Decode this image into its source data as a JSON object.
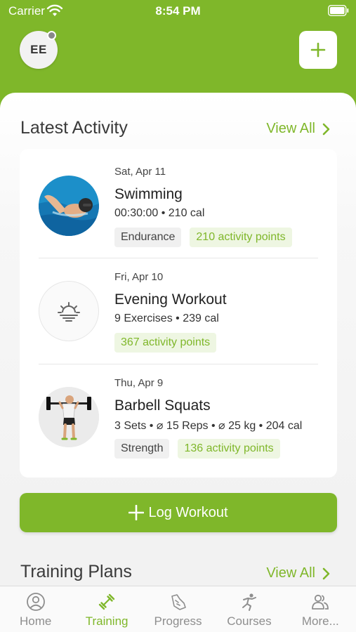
{
  "status_bar": {
    "carrier": "Carrier",
    "time": "8:54 PM"
  },
  "header": {
    "avatar_initials": "EE"
  },
  "latest_activity": {
    "title": "Latest Activity",
    "view_all": "View All",
    "items": [
      {
        "date": "Sat, Apr 11",
        "name": "Swimming",
        "stats": "00:30:00 • 210 cal",
        "tags": [
          {
            "label": "Endurance",
            "style": "grey"
          },
          {
            "label": "210 activity points",
            "style": "green"
          }
        ]
      },
      {
        "date": "Fri, Apr 10",
        "name": "Evening Workout",
        "stats": "9 Exercises • 239 cal",
        "tags": [
          {
            "label": "367 activity points",
            "style": "green"
          }
        ]
      },
      {
        "date": "Thu, Apr 9",
        "name": "Barbell Squats",
        "stats": "3 Sets • ⌀ 15 Reps • ⌀ 25 kg • 204 cal",
        "tags": [
          {
            "label": "Strength",
            "style": "grey"
          },
          {
            "label": "136 activity points",
            "style": "green"
          }
        ]
      }
    ]
  },
  "log_workout": {
    "label": "Log Workout"
  },
  "training_plans": {
    "title": "Training Plans",
    "view_all": "View All"
  },
  "tab_bar": {
    "items": [
      {
        "label": "Home",
        "icon": "person-icon",
        "active": false
      },
      {
        "label": "Training",
        "icon": "dumbbell-icon",
        "active": true
      },
      {
        "label": "Progress",
        "icon": "progress-icon",
        "active": false
      },
      {
        "label": "Courses",
        "icon": "running-figure-icon",
        "active": false
      },
      {
        "label": "More...",
        "icon": "people-icon",
        "active": false
      }
    ]
  },
  "colors": {
    "brand": "#7fb72a",
    "text": "#222222",
    "tag_green_bg": "#eef6e2"
  }
}
